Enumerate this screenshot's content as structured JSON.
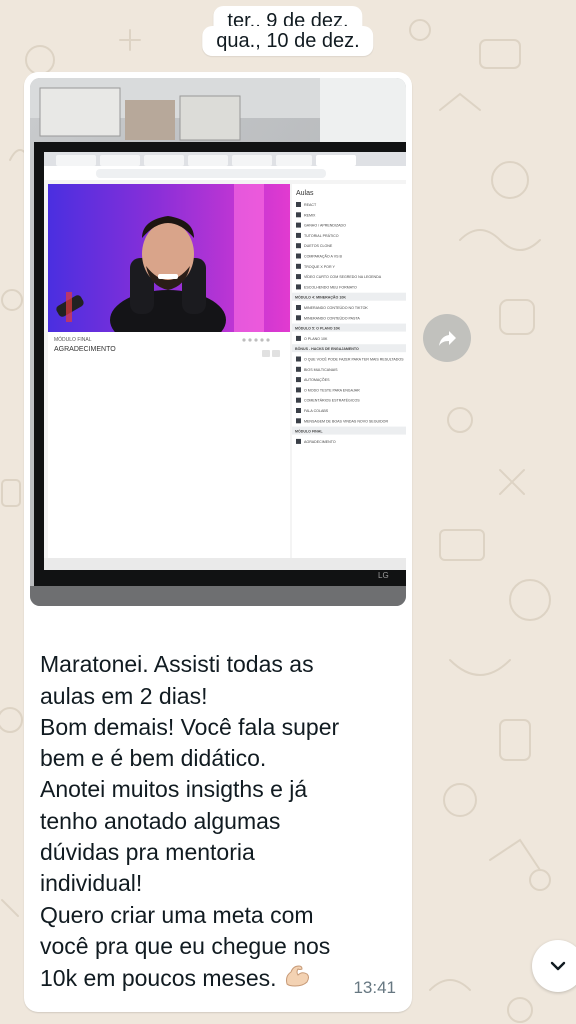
{
  "chat": {
    "date_separators": [
      "ter., 9 de dez.",
      "qua., 10 de dez."
    ],
    "message": {
      "lines": [
        "Maratonei. Assisti todas as",
        "aulas em 2 dias!",
        "Bom demais! Você fala super",
        "bem e é bem didático.",
        "Anotei muitos insigths e já",
        "tenho anotado algumas",
        "dúvidas pra mentoria",
        "individual!",
        "Quero criar uma meta com",
        "você pra que eu chegue nos",
        "10k em poucos meses."
      ],
      "emoji": "flexed-biceps",
      "time": "13:41"
    },
    "buttons": {
      "share_icon": "share-forward-icon",
      "scroll_icon": "chevron-down-icon"
    }
  },
  "photo": {
    "browser_url": "members.kiwify.com/...",
    "video": {
      "module_label": "MÓDULO FINAL",
      "lesson_title": "AGRADECIMENTO"
    },
    "sidebar": {
      "title": "Aulas",
      "items": [
        "REACT",
        "REMIX",
        "GANHO / APRENDIZADO",
        "TUTORIAL PRÁTICO",
        "DUETOS CLONE",
        "COMPARAÇÃO A VS B",
        "TROQUE X POR Y",
        "VÍDEO CURTO COM SEGREDO NA LEGENDA",
        "ESCOLHENDO MEU FORMATO"
      ],
      "sections": [
        {
          "title": "MÓDULO 4: MINERAÇÃO 10K",
          "items": [
            "MINERANDO CONTEÚDO NO TIKTOK",
            "MINERANDO CONTEÚDO PASTA"
          ]
        },
        {
          "title": "MÓDULO 5: O PLANO 10K",
          "items": [
            "O PLANO 10K"
          ]
        },
        {
          "title": "BÔNUS - HACKS DE ENGAJAMENTO",
          "items": [
            "O QUE VOCÊ PODE FAZER PARA TER MAIS RESULTADOS",
            "BIOS MULTICANAIS",
            "AUTOMAÇÕES",
            "O MODO TESTE PARA ENGAJAR",
            "COMENTÁRIOS ESTRATÉGICOS",
            "FALA COLABS",
            "MENSAGEM DE BOAS VINDAS NOVO SEGUIDOR"
          ]
        },
        {
          "title": "MÓDULO FINAL",
          "items": [
            "AGRADECIMENTO"
          ]
        }
      ]
    },
    "monitor_brand": "LG"
  }
}
